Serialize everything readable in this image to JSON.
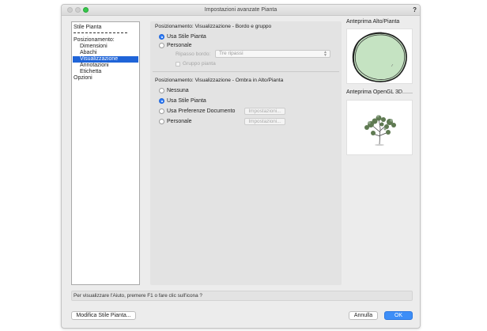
{
  "window": {
    "title": "Impostazioni avanzate Pianta",
    "help_label": "?"
  },
  "sidebar": {
    "items": [
      {
        "label": "Stile Pianta"
      },
      {
        "label": "Posizionamento:"
      },
      {
        "label": "Dimensioni"
      },
      {
        "label": "Abachi"
      },
      {
        "label": "Visualizzazione"
      },
      {
        "label": "Annotazioni"
      },
      {
        "label": "Etichetta"
      },
      {
        "label": "Opzioni"
      }
    ],
    "selected": "Visualizzazione"
  },
  "main": {
    "border_section": {
      "title": "Posizionamento: Visualizzazione - Bordo e gruppo",
      "options": [
        "Usa Stile Pianta",
        "Personale"
      ],
      "selected": "Usa Stile Pianta",
      "ripasso_label": "Ripasso bordo:",
      "ripasso_value": "Tre ripassi",
      "gruppo_label": "Gruppo pianta"
    },
    "shadow_section": {
      "title": "Posizionamento: Visualizzazione - Ombra in Alto/Pianta",
      "options": [
        "Nessuna",
        "Usa Stile Pianta",
        "Usa Preferenze Documento",
        "Personale"
      ],
      "selected": "Usa Stile Pianta",
      "settings_button": "Impostazioni..."
    }
  },
  "preview": {
    "top_title": "Anteprima Alto/Pianta",
    "opengl_title": "Anteprima OpenGL 3D"
  },
  "status_text": "Per visualizzare l'Aiuto, premere F1 o fare clic sull'icona ?",
  "footer": {
    "modify_button": "Modifica Stile Pianta...",
    "cancel_button": "Annulla",
    "ok_button": "OK"
  },
  "colors": {
    "selection": "#1f64d8",
    "accent": "#3d8ef7",
    "plant_fill": "#c5e3c2"
  }
}
